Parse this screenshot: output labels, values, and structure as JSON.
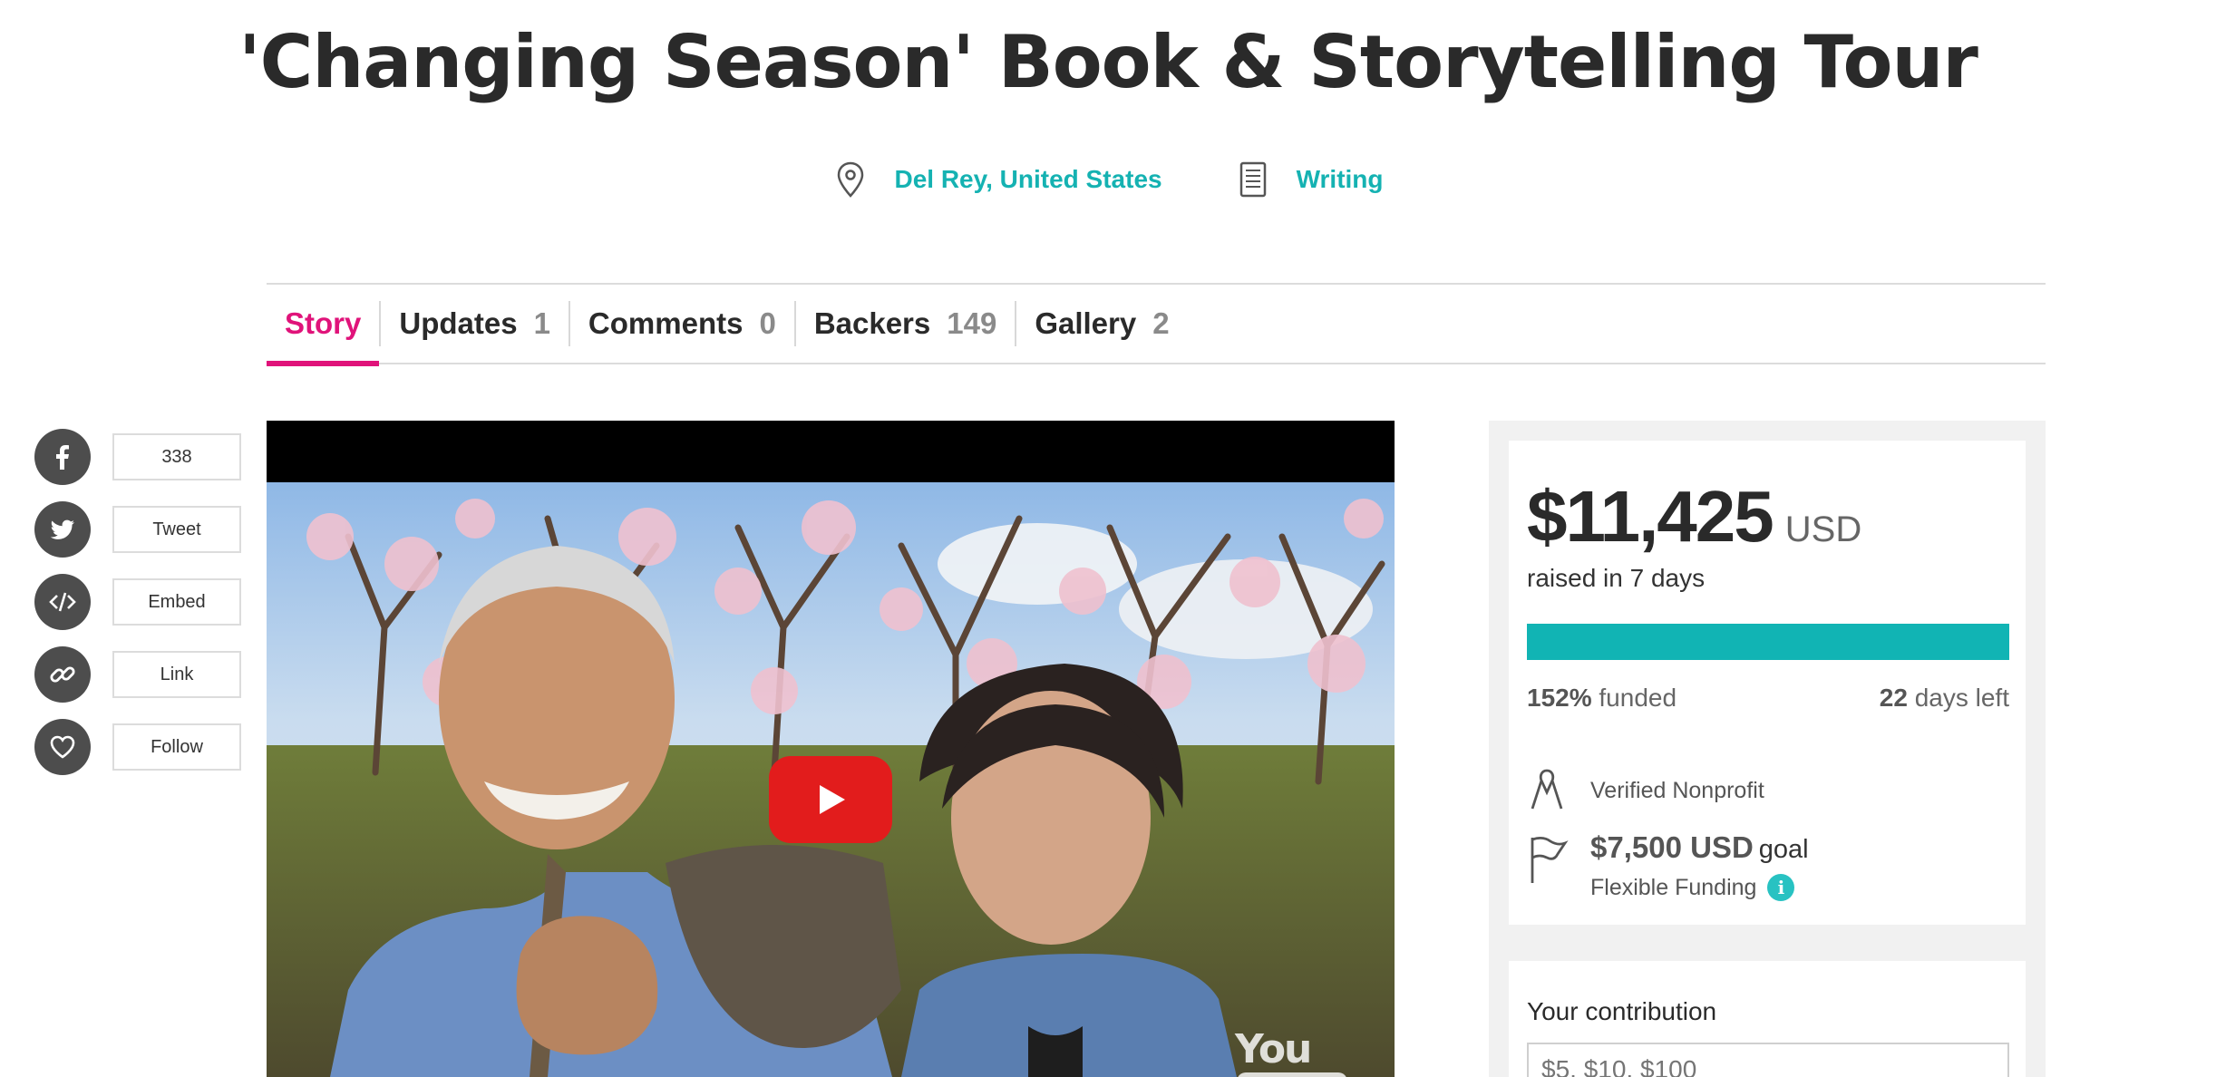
{
  "campaign": {
    "title": "'Changing Season' Book & Storytelling Tour",
    "location": "Del Rey, United States",
    "category": "Writing"
  },
  "tabs": [
    {
      "label": "Story",
      "count": ""
    },
    {
      "label": "Updates",
      "count": "1"
    },
    {
      "label": "Comments",
      "count": "0"
    },
    {
      "label": "Backers",
      "count": "149"
    },
    {
      "label": "Gallery",
      "count": "2"
    }
  ],
  "share": [
    {
      "icon": "facebook-icon",
      "label": "338"
    },
    {
      "icon": "twitter-icon",
      "label": "Tweet"
    },
    {
      "icon": "embed-icon",
      "label": "Embed"
    },
    {
      "icon": "link-icon",
      "label": "Link"
    },
    {
      "icon": "heart-icon",
      "label": "Follow"
    }
  ],
  "video": {
    "provider": "YouTube"
  },
  "funding": {
    "amount": "$11,425",
    "currency": "USD",
    "raised_text": "raised in 7 days",
    "progress": 1.0,
    "funded_percent": "152%",
    "funded_word": "funded",
    "days_left": "22",
    "days_left_text": "days left",
    "verified": "Verified Nonprofit",
    "goal_amount": "$7,500 USD",
    "goal_word": "goal",
    "flexible": "Flexible Funding"
  },
  "contribution": {
    "label": "Your contribution",
    "placeholder": "$5, $10, $100"
  },
  "colors": {
    "accent": "#15b2b2",
    "tab_active": "#e0137a",
    "progress": "#11b4b4",
    "play_button": "#e21c1c"
  }
}
